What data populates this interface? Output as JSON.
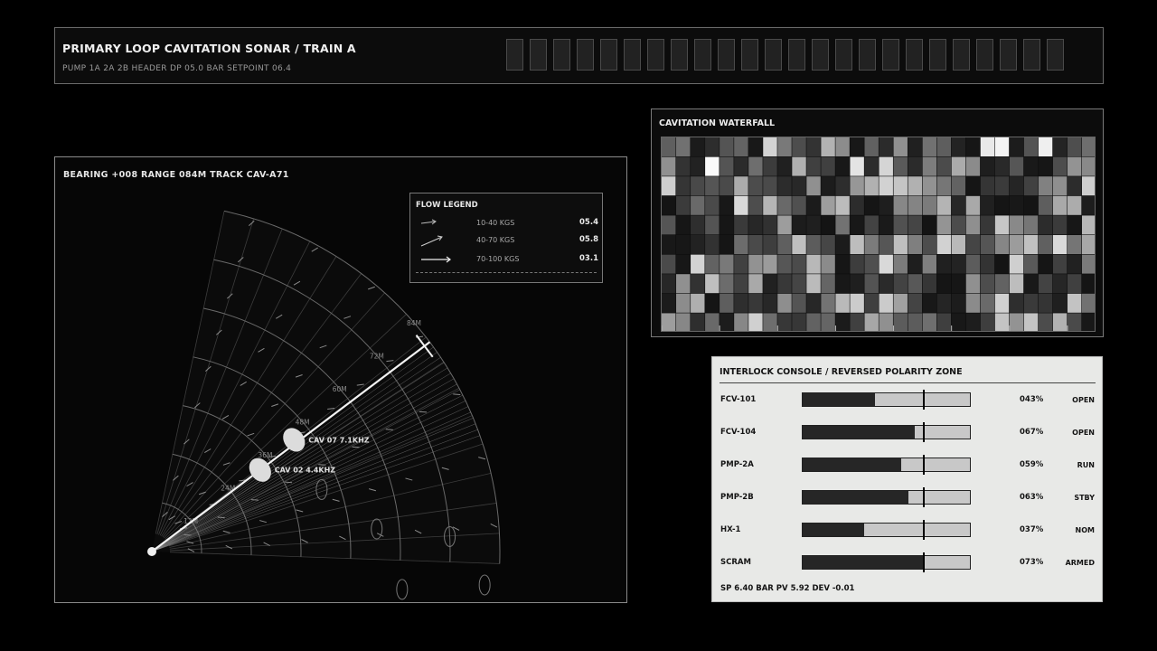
{
  "header": {
    "title": "PRIMARY LOOP CAVITATION SONAR / TRAIN A",
    "subtitle": "PUMP 1A 2A 2B   HEADER DP 05.0 BAR   SETPOINT 06.4",
    "segment_count": 24
  },
  "sonar": {
    "readout": "BEARING +008   RANGE 084M   TRACK CAV-A71",
    "range_labels": [
      "12M",
      "24M",
      "36M",
      "48M",
      "60M",
      "72M",
      "84M"
    ],
    "targets": [
      {
        "label": "CAV 07  7.1KHZ"
      },
      {
        "label": "CAV 02  4.4KHZ"
      }
    ]
  },
  "legend": {
    "title": "FLOW LEGEND",
    "rows": [
      {
        "label": "10-40 KGS",
        "value": "05.4"
      },
      {
        "label": "40-70 KGS",
        "value": "05.8"
      },
      {
        "label": "70-100 KGS",
        "value": "03.1"
      }
    ]
  },
  "waterfall": {
    "title": "CAVITATION WATERFALL",
    "cols": 30,
    "rows": 10
  },
  "console": {
    "title": "INTERLOCK CONSOLE / REVERSED POLARITY ZONE",
    "rows": [
      {
        "name": "FCV-101",
        "pct": "043%",
        "level": 43,
        "state": "OPEN"
      },
      {
        "name": "FCV-104",
        "pct": "067%",
        "level": 67,
        "state": "OPEN"
      },
      {
        "name": "PMP-2A",
        "pct": "059%",
        "level": 59,
        "state": "RUN"
      },
      {
        "name": "PMP-2B",
        "pct": "063%",
        "level": 63,
        "state": "STBY"
      },
      {
        "name": "HX-1",
        "pct": "037%",
        "level": 37,
        "state": "NOM"
      },
      {
        "name": "SCRAM",
        "pct": "073%",
        "level": 73,
        "state": "ARMED"
      }
    ],
    "footer": "SP 6.40 BAR   PV 5.92   DEV -0.01"
  },
  "colors": {
    "background": "#000000",
    "panel_border": "#8a8a8a",
    "console_bg": "#e8e9e7",
    "bar_fill": "#262626"
  }
}
